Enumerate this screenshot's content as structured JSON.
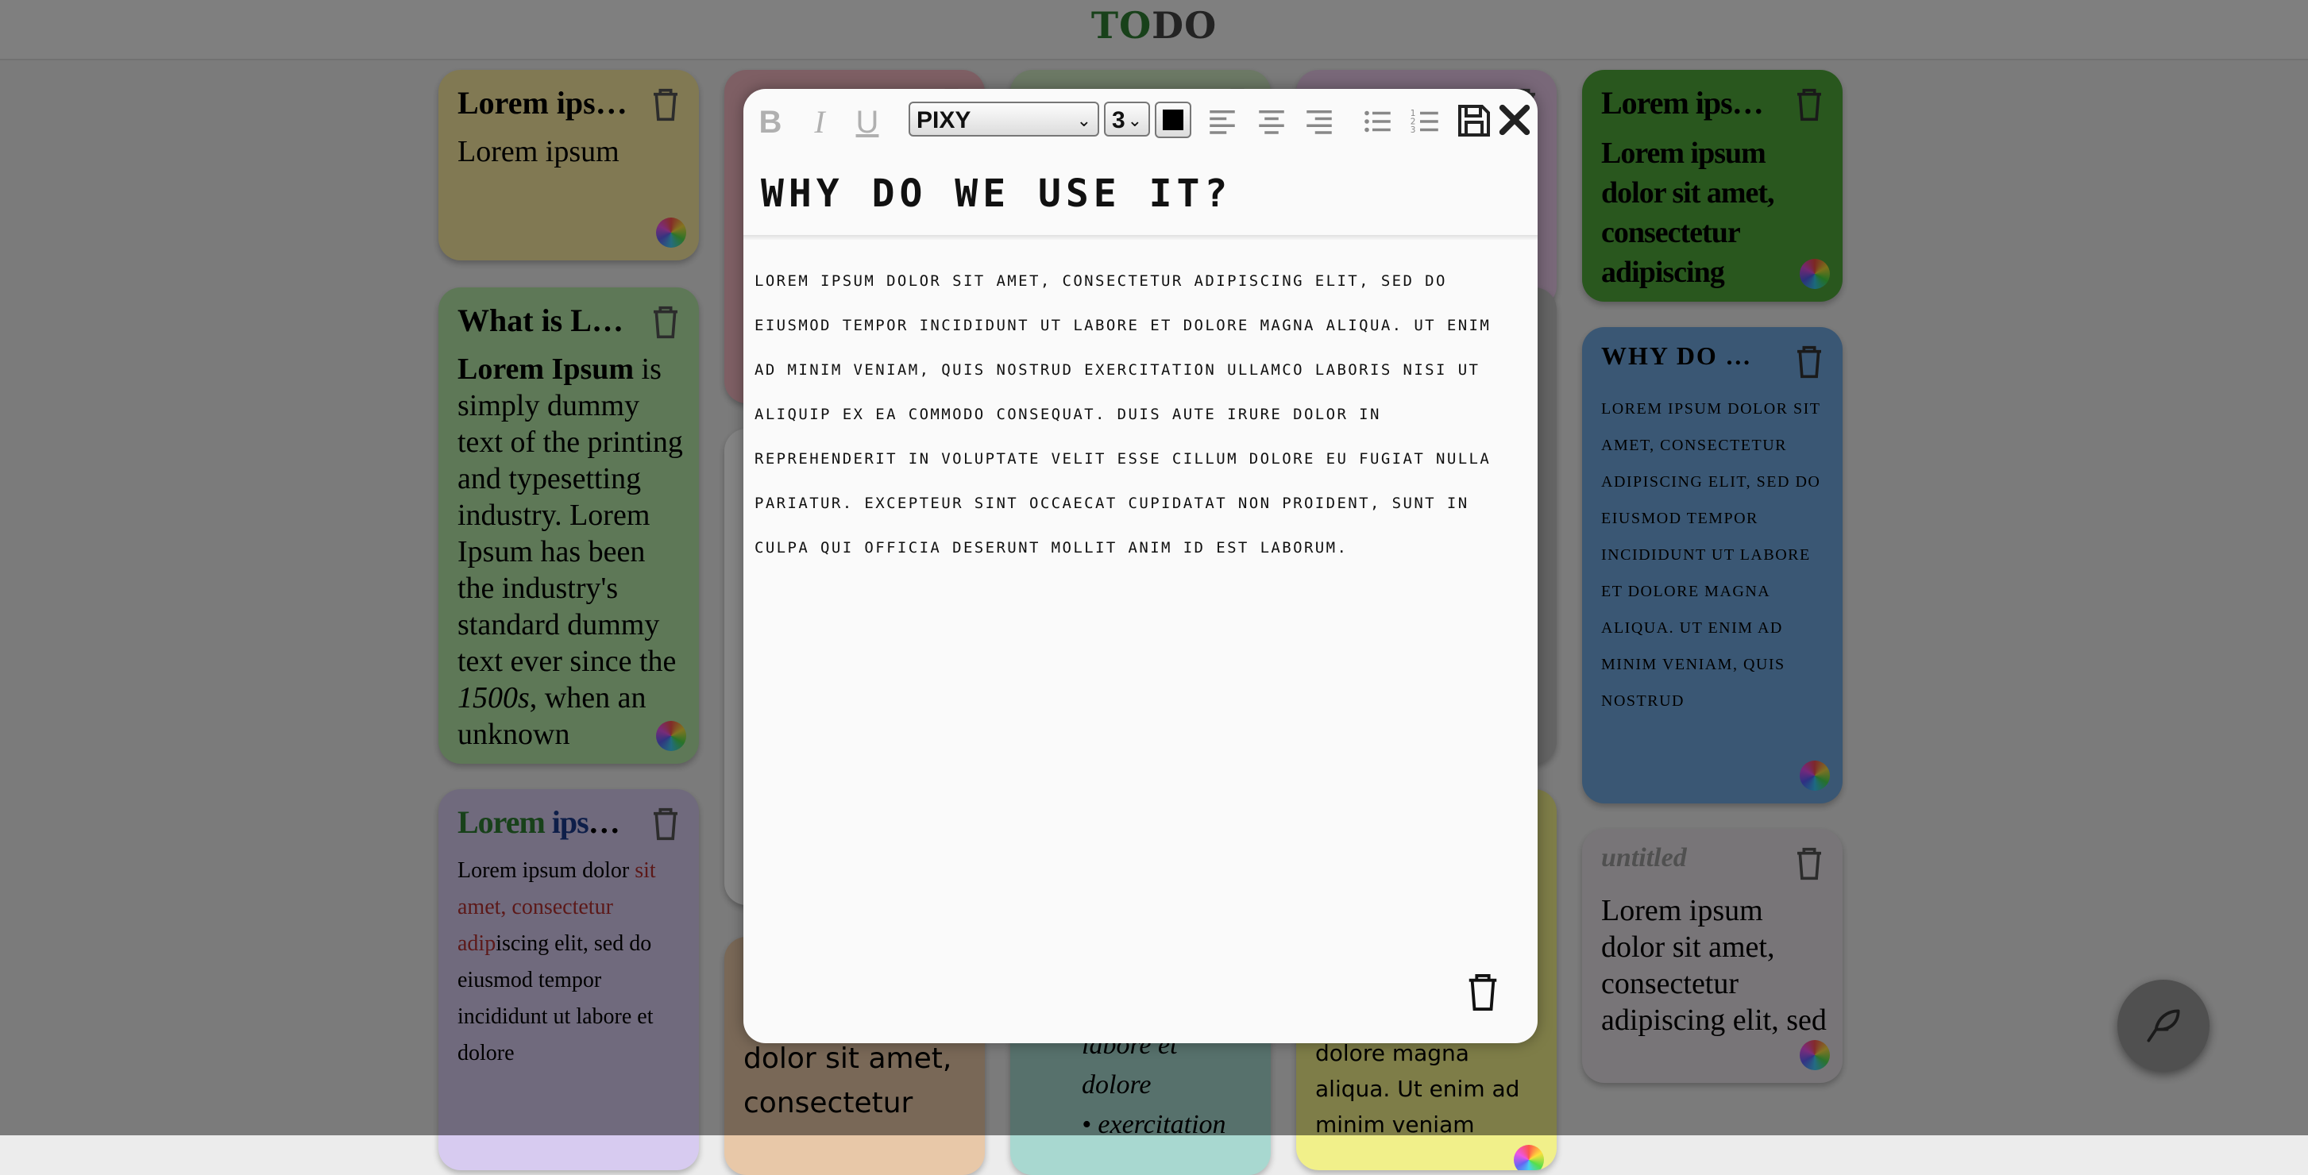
{
  "app": {
    "title_part1": "TO",
    "title_part2": "DO"
  },
  "notes": {
    "n1": {
      "title": "Lorem ipsum",
      "body": "Lorem ipsum"
    },
    "n2": {
      "title": "What is Lorem Ipsum?",
      "body_bold": "Lorem Ipsum",
      "body_text": " is simply dummy text of the printing and typesetting industry. Lorem Ipsum has been the industry's standard dummy text ever since the ",
      "body_italic": "1500s",
      "body_tail": ", when an unknown"
    },
    "n3": {
      "title_green": "Lorem",
      "title_blue": " ipsum dolor",
      "body_a": "Lorem ipsum dolor ",
      "body_red": "sit amet, consectetur adip",
      "body_b": "iscing elit, sed do eiusmod tempor incididunt ut labore et dolore"
    },
    "n4": {
      "body": "dolor sit amet, consectetur"
    },
    "n5": {
      "list_a": "labore et",
      "list_b": "dolore",
      "list_c": "exercitation"
    },
    "n6": {
      "body": "dolore magna aliqua. Ut enim ad minim veniam"
    },
    "n7": {
      "title": "Lorem ipsum",
      "body": "Lorem ipsum dolor sit amet, consectetur adipiscing"
    },
    "n8": {
      "title": "Why do we use it?",
      "body": "Lorem ipsum dolor sit amet, consectetur adipiscing elit, sed do eiusmod tempor incididunt ut labore et dolore magna aliqua. Ut enim ad minim veniam, quis nostrud"
    },
    "n9": {
      "title": "untitled",
      "body": "Lorem ipsum dolor sit amet, consectetur adipiscing elit, sed"
    }
  },
  "editor": {
    "toolbar": {
      "bold": "B",
      "italic": "I",
      "underline": "U",
      "font": "PIXY",
      "size": "3",
      "color": "#000000"
    },
    "title": "Why do we use it?",
    "body": "Lorem ipsum dolor sit amet, consectetur adipiscing elit, sed do eiusmod tempor incididunt ut labore et dolore magna aliqua. Ut enim ad minim veniam, quis nostrud exercitation ullamco laboris nisi ut aliquip ex ea commodo consequat. Duis aute irure dolor in reprehenderit in voluptate velit esse cillum dolore eu fugiat nulla pariatur. Excepteur sint occaecat cupidatat non proident, sunt in culpa qui officia deserunt mollit anim id est laborum."
  },
  "icons": {
    "trash": "trash-icon",
    "color_wheel": "color-wheel-icon",
    "save": "save-icon",
    "close": "close-icon",
    "feather": "feather-icon"
  },
  "colors": {
    "note_yellow": "#f8e9a0",
    "note_green": "#b4e6a8",
    "note_purple": "#d7cbf0",
    "note_pink": "#f2b6c0",
    "note_lime": "#f1f08a",
    "note_darkgreen": "#4fa83a",
    "note_blue": "#6fa7de",
    "note_gray": "#e6e1e6",
    "accent_green": "#2e7d32"
  }
}
